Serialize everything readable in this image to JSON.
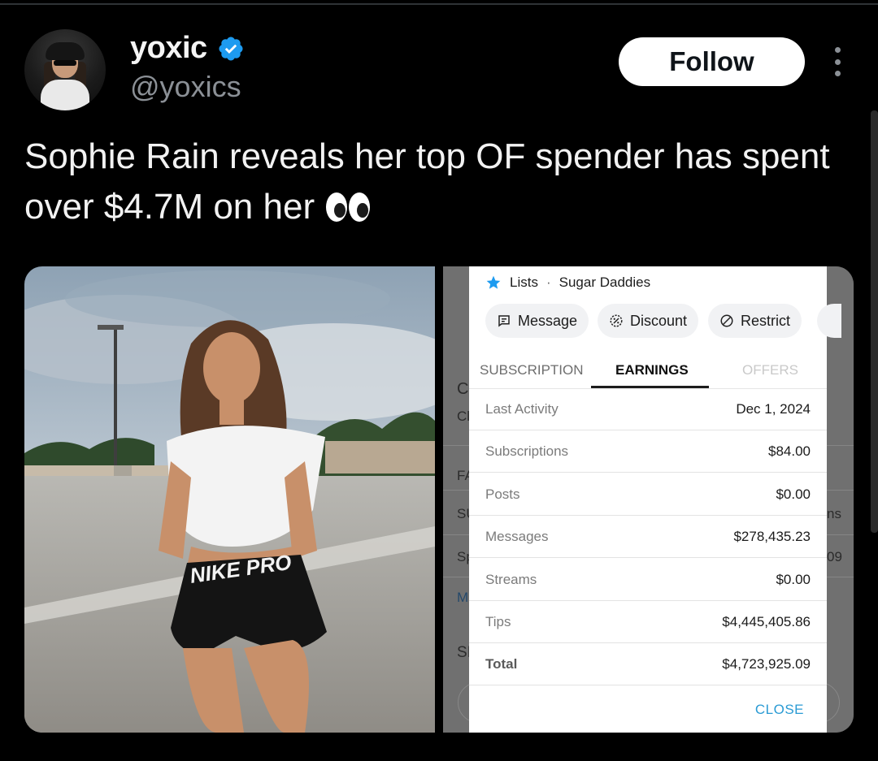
{
  "author": {
    "display_name": "yoxic",
    "handle": "@yoxics"
  },
  "actions": {
    "follow_label": "Follow"
  },
  "tweet": {
    "text": "Sophie Rain reveals her top OF spender has spent over $4.7M on her"
  },
  "screenshot_card": {
    "lists_label": "Lists",
    "list_name": "Sugar Daddies",
    "chips": [
      "Message",
      "Discount",
      "Restrict"
    ],
    "tabs": [
      "SUBSCRIPTION",
      "EARNINGS",
      "OFFERS"
    ],
    "active_tab": "EARNINGS",
    "rows": [
      {
        "label": "Last Activity",
        "value": "Dec 1, 2024"
      },
      {
        "label": "Subscriptions",
        "value": "$84.00"
      },
      {
        "label": "Posts",
        "value": "$0.00"
      },
      {
        "label": "Messages",
        "value": "$278,435.23"
      },
      {
        "label": "Streams",
        "value": "$0.00"
      },
      {
        "label": "Tips",
        "value": "$4,445,405.86"
      },
      {
        "label": "Total",
        "value": "$4,723,925.09"
      }
    ],
    "close_label": "CLOSE"
  },
  "background_fragments": {
    "letters": [
      "C",
      "Cl",
      "FA",
      "SU",
      "Sp",
      "M",
      "SI"
    ],
    "right": [
      "ns",
      "09"
    ]
  },
  "colors": {
    "verified_badge": "#1d9bf0",
    "close_link": "#2a9bd4",
    "star": "#1d9bf0"
  }
}
